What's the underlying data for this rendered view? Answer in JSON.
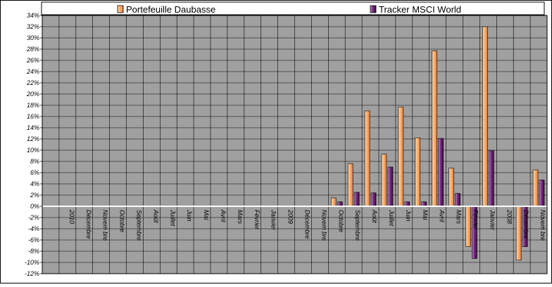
{
  "chart_data": {
    "type": "bar",
    "title": "",
    "xlabel": "",
    "ylabel": "",
    "ylim": [
      -12,
      34
    ],
    "yticks": [
      -12,
      -10,
      -8,
      -6,
      -4,
      -2,
      0,
      2,
      4,
      6,
      8,
      10,
      12,
      14,
      16,
      18,
      20,
      22,
      24,
      26,
      28,
      30,
      32,
      34
    ],
    "ytick_labels": [
      "-12%",
      "-10%",
      "-8%",
      "-6%",
      "-4%",
      "-2%",
      "0%",
      "2%",
      "4%",
      "6%",
      "8%",
      "10%",
      "12%",
      "14%",
      "16%",
      "18%",
      "20%",
      "22%",
      "24%",
      "26%",
      "28%",
      "30%",
      "32%",
      "34%"
    ],
    "grid": true,
    "legend_position": "top",
    "plot_background": "#a0a0a0",
    "categories": [
      "",
      "2010",
      "Décembre",
      "Novembre",
      "Octobre",
      "Septembre",
      "Août",
      "Juillet",
      "Juin",
      "Mai",
      "Avril",
      "Mars",
      "Février",
      "Janvier",
      "2009",
      "Décembre",
      "Novembre",
      "Octobre",
      "Septembre",
      "Août",
      "Juillet",
      "Juin",
      "Mai",
      "Avril",
      "Mars",
      "Février",
      "Janvier",
      "2008",
      "Décembre",
      "Novembre"
    ],
    "category_labels": [
      "",
      "2010",
      "Décembre",
      "Novem bre",
      "Octobre",
      "Septembre",
      "Août",
      "Juillet",
      "Juin",
      "Mai",
      "Avril",
      "Mars",
      "Février",
      "Janvier",
      "2009",
      "Décembre",
      "Novem bre",
      "Octobre",
      "Septembre",
      "Août",
      "Juillet",
      "Juin",
      "Mai",
      "Avril",
      "Mars",
      "Février",
      "Janvier",
      "2008",
      "Décembre",
      "Novem bre"
    ],
    "series": [
      {
        "name": "Portefeuille Daubasse",
        "color": "#ffb070",
        "values": [
          null,
          null,
          null,
          null,
          null,
          null,
          null,
          null,
          null,
          null,
          null,
          null,
          null,
          null,
          null,
          null,
          null,
          1.5,
          7.6,
          17.0,
          9.3,
          17.7,
          12.2,
          27.7,
          6.8,
          -7.2,
          32.0,
          null,
          -9.6,
          6.5
        ]
      },
      {
        "name": "Tracker MSCI World",
        "color": "#7a2a80",
        "values": [
          null,
          null,
          null,
          null,
          null,
          null,
          null,
          null,
          null,
          null,
          null,
          null,
          null,
          null,
          null,
          null,
          null,
          0.8,
          2.5,
          2.4,
          7.0,
          0.8,
          0.8,
          12.1,
          2.3,
          -9.3,
          9.9,
          null,
          -7.2,
          4.7
        ]
      }
    ]
  }
}
